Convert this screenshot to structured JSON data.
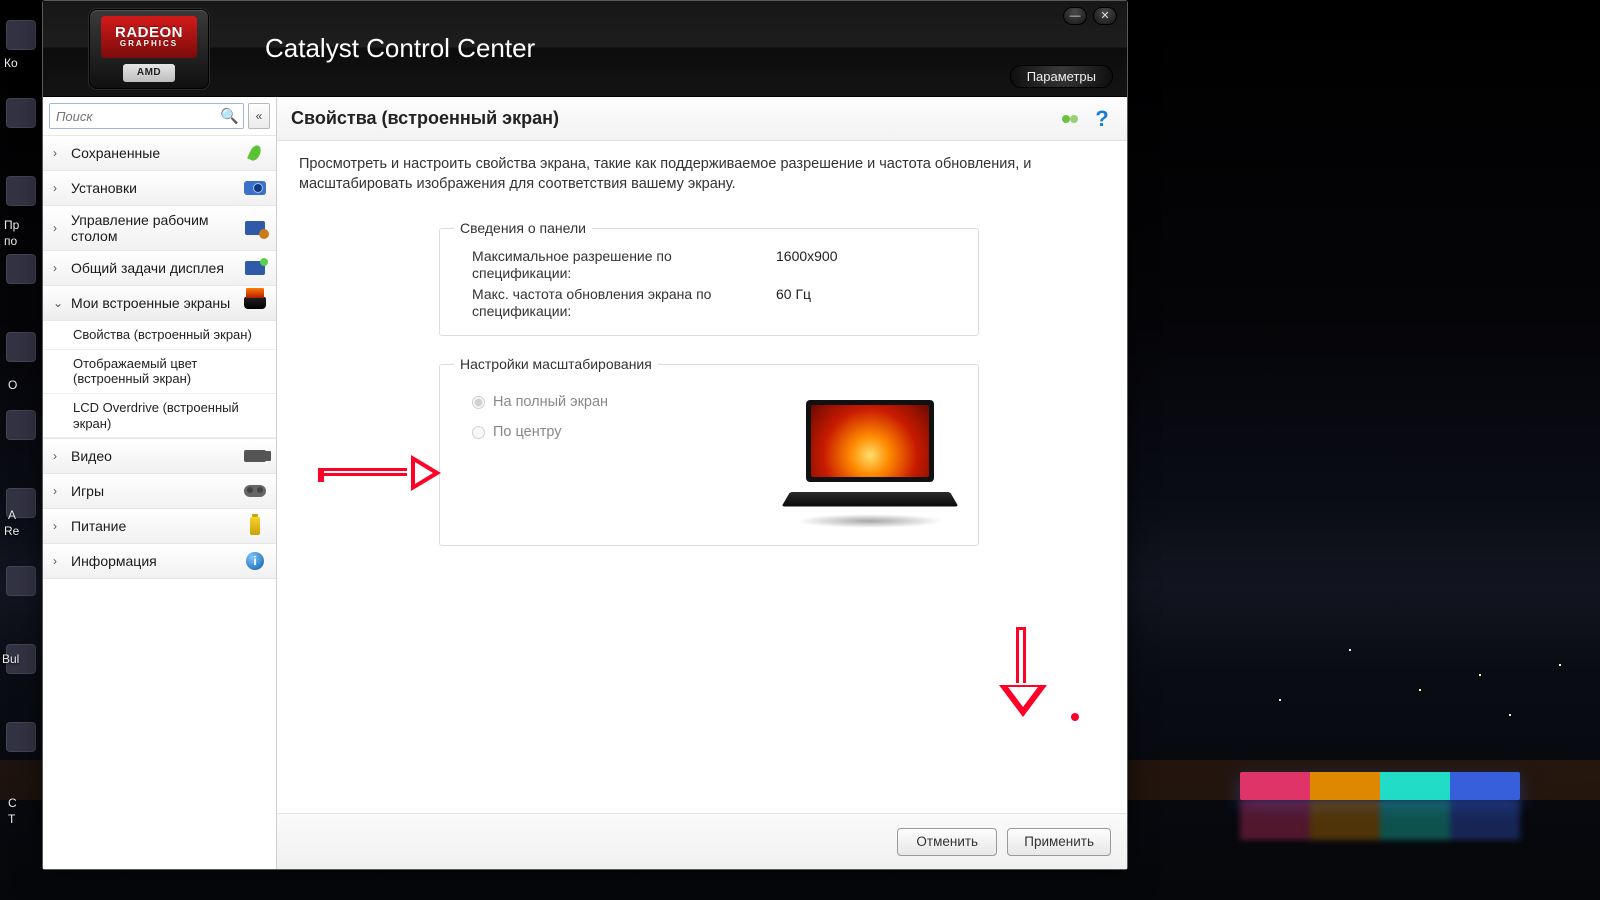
{
  "app_title": "Catalyst Control Center",
  "badge": {
    "brand_top": "RADEON",
    "brand_sub": "GRAPHICS",
    "brand_bottom": "AMD"
  },
  "window_controls": {
    "minimize": "—",
    "close": "✕"
  },
  "params_button": "Параметры",
  "search": {
    "placeholder": "Поиск"
  },
  "collapse_glyph": "«",
  "help_glyph": "?",
  "sidebar": {
    "items": [
      {
        "label": "Сохраненные",
        "icon": "pin"
      },
      {
        "label": "Установки",
        "icon": "cam"
      },
      {
        "label": "Управление рабочим столом",
        "icon": "desk"
      },
      {
        "label": "Общий задачи дисплея",
        "icon": "mon"
      },
      {
        "label": "Мои встроенные экраны",
        "icon": "lap",
        "expanded": true
      },
      {
        "label": "Видео",
        "icon": "vid"
      },
      {
        "label": "Игры",
        "icon": "game"
      },
      {
        "label": "Питание",
        "icon": "bat"
      },
      {
        "label": "Информация",
        "icon": "info"
      }
    ],
    "sub_screens": [
      "Свойства (встроенный экран)",
      "Отображаемый цвет (встроенный экран)",
      "LCD Overdrive (встроенный экран)"
    ]
  },
  "content": {
    "title": "Свойства (встроенный экран)",
    "description": "Просмотреть и настроить свойства экрана, такие как поддерживаемое разрешение и частота обновления, и масштабировать изображения для соответствия вашему экрану.",
    "panel_info": {
      "legend": "Сведения о панели",
      "rows": [
        {
          "label": "Максимальное разрешение по спецификации:",
          "value": "1600x900"
        },
        {
          "label": "Макс. частота обновления экрана по спецификации:",
          "value": "60 Гц"
        }
      ]
    },
    "scaling": {
      "legend": "Настройки масштабирования",
      "options": [
        {
          "label": "На полный экран",
          "selected": true
        },
        {
          "label": "По центру",
          "selected": false
        }
      ]
    }
  },
  "footer": {
    "cancel": "Отменить",
    "apply": "Применить"
  },
  "desktop_labels": {
    "l0": "Ко",
    "l1": "Пр",
    "l2": "по",
    "l3": "О",
    "l4": "А",
    "l5": "Re",
    "l6": "Bul",
    "l7": "С",
    "l8": "Т"
  }
}
